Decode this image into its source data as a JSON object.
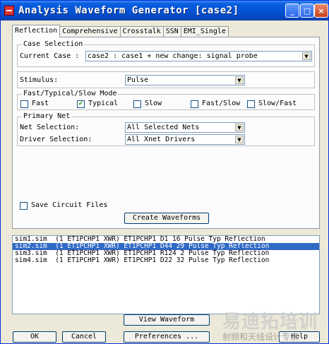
{
  "window": {
    "title": "Analysis Waveform Generator [case2]",
    "controls": {
      "minimize": "_",
      "maximize": "□",
      "close": "×"
    }
  },
  "tabs": [
    "Reflection",
    "Comprehensive",
    "Crosstalk",
    "SSN",
    "EMI_Single"
  ],
  "case_selection": {
    "legend": "Case Selection",
    "label": "Current Case :",
    "value": "case2 : case1 + new change: signal probe"
  },
  "stimulus": {
    "label": "Stimulus:",
    "value": "Pulse"
  },
  "mode": {
    "legend": "Fast/Typical/Slow Mode",
    "options": [
      {
        "label": "Fast",
        "checked": false
      },
      {
        "label": "Typical",
        "checked": true
      },
      {
        "label": "Slow",
        "checked": false
      },
      {
        "label": "Fast/Slow",
        "checked": false
      },
      {
        "label": "Slow/Fast",
        "checked": false
      }
    ]
  },
  "primary_net": {
    "legend": "Primary Net",
    "net_label": "Net Selection:",
    "net_value": "All Selected Nets",
    "driver_label": "Driver Selection:",
    "driver_value": "All Xnet Drivers"
  },
  "save_circuit": {
    "label": "Save Circuit Files",
    "checked": false
  },
  "create_button": "Create Waveforms",
  "waveforms": [
    {
      "text": "sim1.sim  (1 ET1PCHP1 XWR) ET1PCHP1 D1 16 Pulse Typ Reflection",
      "selected": false
    },
    {
      "text": "sim2.sim  (1 ET1PCHP1 XWR) ET1PCHP1 D44 29 Pulse Typ Reflection",
      "selected": true
    },
    {
      "text": "sim3.sim  (1 ET1PCHP1 XWR) ET1PCHP1 R124 2 Pulse Typ Reflection",
      "selected": false
    },
    {
      "text": "sim4.sim  (1 ET1PCHP1 XWR) ET1PCHP1 D22 32 Pulse Typ Reflection",
      "selected": false
    }
  ],
  "view_button": "View Waveform",
  "footer": {
    "ok": "OK",
    "cancel": "Cancel",
    "preferences": "Preferences ...",
    "help": "Help"
  },
  "watermark": {
    "line1": "易迪拓培训",
    "line2": "射频和天线设计专家"
  },
  "colors": {
    "title_bar": "#0454d6",
    "selection": "#316ac5",
    "face": "#ece9d8"
  }
}
